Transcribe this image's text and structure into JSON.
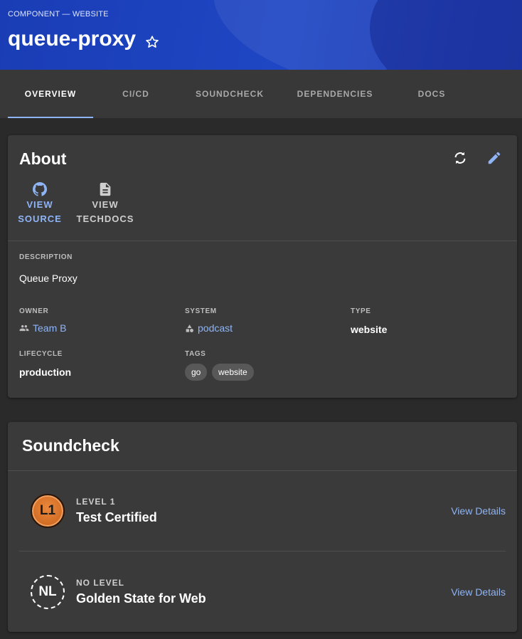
{
  "header": {
    "kind": "COMPONENT — WEBSITE",
    "title": "queue-proxy",
    "star_icon": "star-outline-icon"
  },
  "tabs": [
    {
      "label": "OVERVIEW",
      "active": true
    },
    {
      "label": "CI/CD",
      "active": false
    },
    {
      "label": "SOUNDCHECK",
      "active": false
    },
    {
      "label": "DEPENDENCIES",
      "active": false
    },
    {
      "label": "DOCS",
      "active": false
    }
  ],
  "about": {
    "title": "About",
    "refresh_icon": "refresh-icon",
    "edit_icon": "edit-icon",
    "view_source": {
      "label": "VIEW\nSOURCE",
      "icon": "github-icon"
    },
    "view_techdocs": {
      "label": "VIEW\nTECHDOCS",
      "icon": "document-icon"
    },
    "description_label": "DESCRIPTION",
    "description": "Queue Proxy",
    "owner_label": "OWNER",
    "owner": "Team B",
    "system_label": "SYSTEM",
    "system": "podcast",
    "type_label": "TYPE",
    "type": "website",
    "lifecycle_label": "LIFECYCLE",
    "lifecycle": "production",
    "tags_label": "TAGS",
    "tags": [
      "go",
      "website"
    ]
  },
  "soundcheck": {
    "title": "Soundcheck",
    "items": [
      {
        "badge": "L1",
        "level": "LEVEL 1",
        "name": "Test Certified",
        "action": "View Details"
      },
      {
        "badge": "NL",
        "level": "NO LEVEL",
        "name": "Golden State for Web",
        "action": "View Details"
      }
    ]
  },
  "colors": {
    "header_blue": "#1f46c4",
    "link_blue": "#8fb4f5",
    "level1_orange": "#d9722a"
  }
}
